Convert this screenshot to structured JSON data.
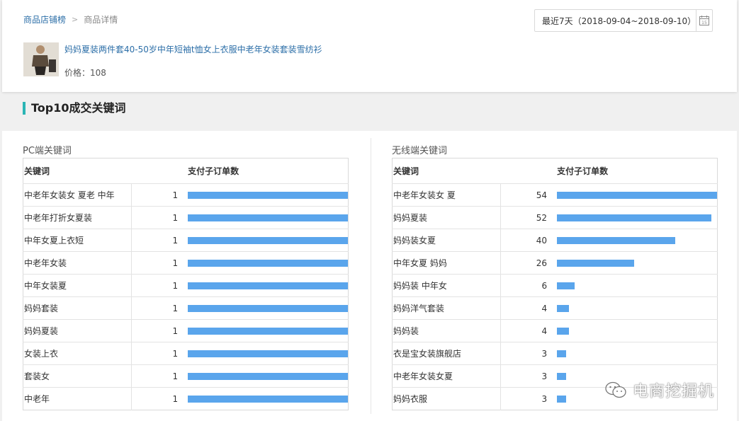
{
  "breadcrumb": {
    "parent": "商品店铺榜",
    "separator": ">",
    "current": "商品详情"
  },
  "date_range": {
    "label": "最近7天（2018-09-04~2018-09-10）",
    "calendar_day": "15"
  },
  "product": {
    "title": "妈妈夏装两件套40-50岁中年短袖t恤女上衣服中老年女装套装雪纺衫",
    "price_label": "价格：108"
  },
  "section": {
    "title": "Top10成交关键词"
  },
  "pc": {
    "title": "PC端关键词",
    "col_keyword": "关键词",
    "col_orders": "支付子订单数",
    "max": 1,
    "rows": [
      {
        "keyword": "中老年女装女 夏老 中年",
        "orders": 1
      },
      {
        "keyword": "中老年打折女夏装",
        "orders": 1
      },
      {
        "keyword": "中年女夏上衣短",
        "orders": 1
      },
      {
        "keyword": "中老年女装",
        "orders": 1
      },
      {
        "keyword": "中年女装夏",
        "orders": 1
      },
      {
        "keyword": "妈妈套装",
        "orders": 1
      },
      {
        "keyword": "妈妈夏装",
        "orders": 1
      },
      {
        "keyword": "女装上衣",
        "orders": 1
      },
      {
        "keyword": "套装女",
        "orders": 1
      },
      {
        "keyword": "中老年",
        "orders": 1
      }
    ]
  },
  "mobile": {
    "title": "无线端关键词",
    "col_keyword": "关键词",
    "col_orders": "支付子订单数",
    "max": 54,
    "rows": [
      {
        "keyword": "中老年女装女 夏",
        "orders": 54
      },
      {
        "keyword": "妈妈夏装",
        "orders": 52
      },
      {
        "keyword": "妈妈装女夏",
        "orders": 40
      },
      {
        "keyword": "中年女夏 妈妈",
        "orders": 26
      },
      {
        "keyword": "妈妈装 中年女",
        "orders": 6
      },
      {
        "keyword": "妈妈洋气套装",
        "orders": 4
      },
      {
        "keyword": "妈妈装",
        "orders": 4
      },
      {
        "keyword": "衣是宝女装旗舰店",
        "orders": 3
      },
      {
        "keyword": "中老年女装女夏",
        "orders": 3
      },
      {
        "keyword": "妈妈衣服",
        "orders": 3
      }
    ]
  },
  "watermark": {
    "text": "电商挖掘机"
  },
  "colors": {
    "bar": "#5aa5ec",
    "accent": "#2bb5b5",
    "link": "#2d6fa8"
  },
  "icons": {
    "calendar": "calendar-icon",
    "wechat": "wechat-icon"
  }
}
